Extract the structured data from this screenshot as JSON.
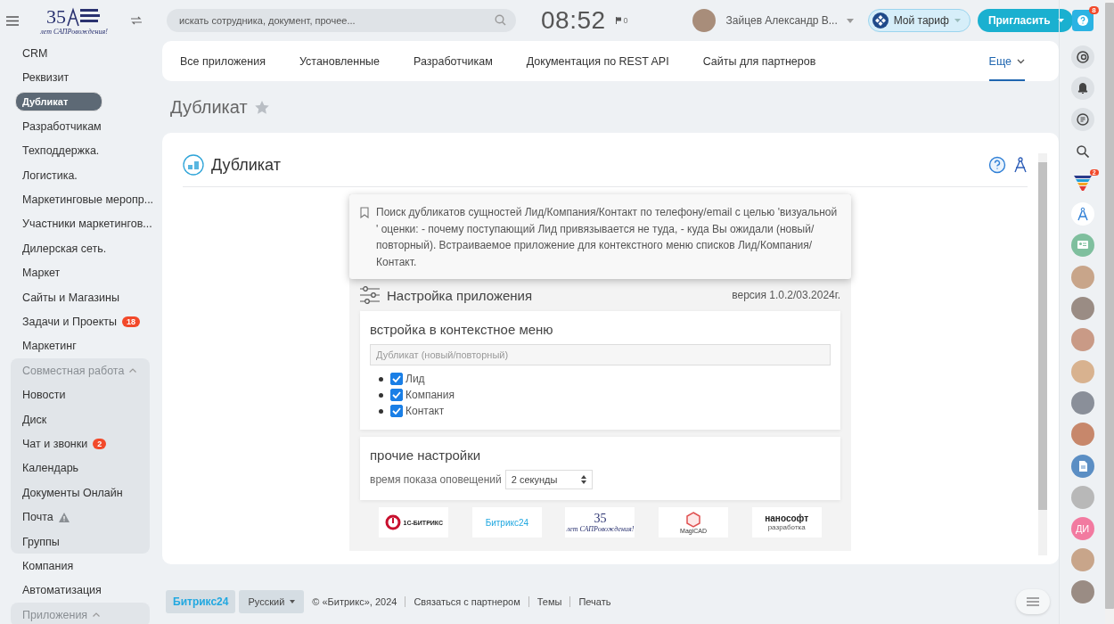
{
  "header": {
    "logo": {
      "number": "35",
      "tagline": "лет САПРовождения!"
    },
    "search": {
      "placeholder": "искать сотрудника, документ, прочее..."
    },
    "clock": "08:52",
    "flag_count": "0",
    "user": {
      "name": "Зайцев Александр В..."
    },
    "tariff": "Мой тариф",
    "invite": "Пригласить",
    "help_badge": "8"
  },
  "sidebar": {
    "items": [
      {
        "kind": "item",
        "label": "CRM",
        "selected": false
      },
      {
        "kind": "item",
        "label": "Реквизит",
        "selected": false
      },
      {
        "kind": "item",
        "label": "Дубликат",
        "selected": true
      },
      {
        "kind": "item",
        "label": "Разработчикам",
        "selected": false
      },
      {
        "kind": "item",
        "label": "Техподдержка.",
        "selected": false
      },
      {
        "kind": "item",
        "label": "Логистика.",
        "selected": false
      },
      {
        "kind": "item",
        "label": "Маркетинговые меропр...",
        "selected": false
      },
      {
        "kind": "item",
        "label": "Участники маркетингов...",
        "selected": false
      },
      {
        "kind": "item",
        "label": "Дилерская сеть.",
        "selected": false
      },
      {
        "kind": "item",
        "label": "Маркет",
        "selected": false
      },
      {
        "kind": "item",
        "label": "Сайты и Магазины",
        "selected": false
      },
      {
        "kind": "item",
        "label": "Задачи и Проекты",
        "selected": false,
        "badge": "18"
      },
      {
        "kind": "item",
        "label": "Маркетинг",
        "selected": false
      },
      {
        "kind": "group",
        "label": "Совместная работа",
        "expanded": true,
        "children": [
          {
            "kind": "item",
            "label": "Новости",
            "selected": false
          },
          {
            "kind": "item",
            "label": "Диск",
            "selected": false
          },
          {
            "kind": "item",
            "label": "Чат и звонки",
            "selected": false,
            "badge": "2"
          },
          {
            "kind": "item",
            "label": "Календарь",
            "selected": false
          },
          {
            "kind": "item",
            "label": "Документы Онлайн",
            "selected": false
          },
          {
            "kind": "item",
            "label": "Почта",
            "selected": false,
            "warning": true
          },
          {
            "kind": "item",
            "label": "Группы",
            "selected": false
          }
        ]
      },
      {
        "kind": "item",
        "label": "Компания",
        "selected": false
      },
      {
        "kind": "item",
        "label": "Автоматизация",
        "selected": false
      },
      {
        "kind": "group",
        "label": "Приложения",
        "expanded": true
      }
    ]
  },
  "tabs": [
    {
      "label": "Все приложения",
      "selected": false
    },
    {
      "label": "Установленные",
      "selected": false
    },
    {
      "label": "Разработчикам",
      "selected": false
    },
    {
      "label": "Документация по REST API",
      "selected": false
    },
    {
      "label": "Сайты для партнеров",
      "selected": false
    },
    {
      "label": "Еще",
      "selected": true,
      "dropdown": true
    }
  ],
  "page_title": "Дубликат",
  "favorite": false,
  "app": {
    "title": "Дубликат",
    "description": "Поиск дубликатов сущностей Лид/Компания/Контакт по телефону/email с целью 'визуальной ' оценки: - почему поступающий Лид привязывается не туда, - куда Вы ожидали (новый/повторный). Встраиваемое приложение для контекстного меню списков Лид/Компания/Контакт.",
    "settings_title": "Настройка приложения",
    "version": "версия 1.0.2/03.2024г.",
    "menu_section": {
      "title": "встройка в контекстное меню",
      "placeholder": "Дубликат (новый/повторный)",
      "entities": [
        {
          "label": "Лид",
          "checked": true
        },
        {
          "label": "Компания",
          "checked": true
        },
        {
          "label": "Контакт",
          "checked": true
        }
      ]
    },
    "other_section": {
      "title": "прочие настройки",
      "label": "время показа оповещений",
      "value": "2 секунды"
    },
    "partners": [
      {
        "kind": "bitrix1c",
        "text": "1С-БИТРИКС"
      },
      {
        "kind": "bitrix24",
        "text": "Битрикс24"
      },
      {
        "kind": "spk",
        "text": "35",
        "subtext": "лет САПРовождения!"
      },
      {
        "kind": "magicad",
        "text": "MagiCAD"
      },
      {
        "kind": "nanosoft",
        "text": "нанософт",
        "subtext": "разработка"
      }
    ]
  },
  "footer": {
    "brand": "Битрикс24",
    "language": "Русский",
    "links": [
      "© «Битрикс», 2024",
      "Связаться с партнером",
      "Темы",
      "Печать"
    ]
  },
  "rail": [
    {
      "kind": "copilot"
    },
    {
      "kind": "bell"
    },
    {
      "kind": "chat"
    },
    {
      "kind": "search"
    },
    {
      "kind": "funnel",
      "badge": "2"
    },
    {
      "kind": "compass"
    },
    {
      "kind": "contacts"
    },
    {
      "kind": "avatar"
    },
    {
      "kind": "avatar"
    },
    {
      "kind": "avatar"
    },
    {
      "kind": "avatar"
    },
    {
      "kind": "avatar"
    },
    {
      "kind": "avatar"
    },
    {
      "kind": "document"
    },
    {
      "kind": "avatar"
    },
    {
      "kind": "initials",
      "text": "ДИ"
    },
    {
      "kind": "avatar"
    },
    {
      "kind": "avatar"
    }
  ]
}
